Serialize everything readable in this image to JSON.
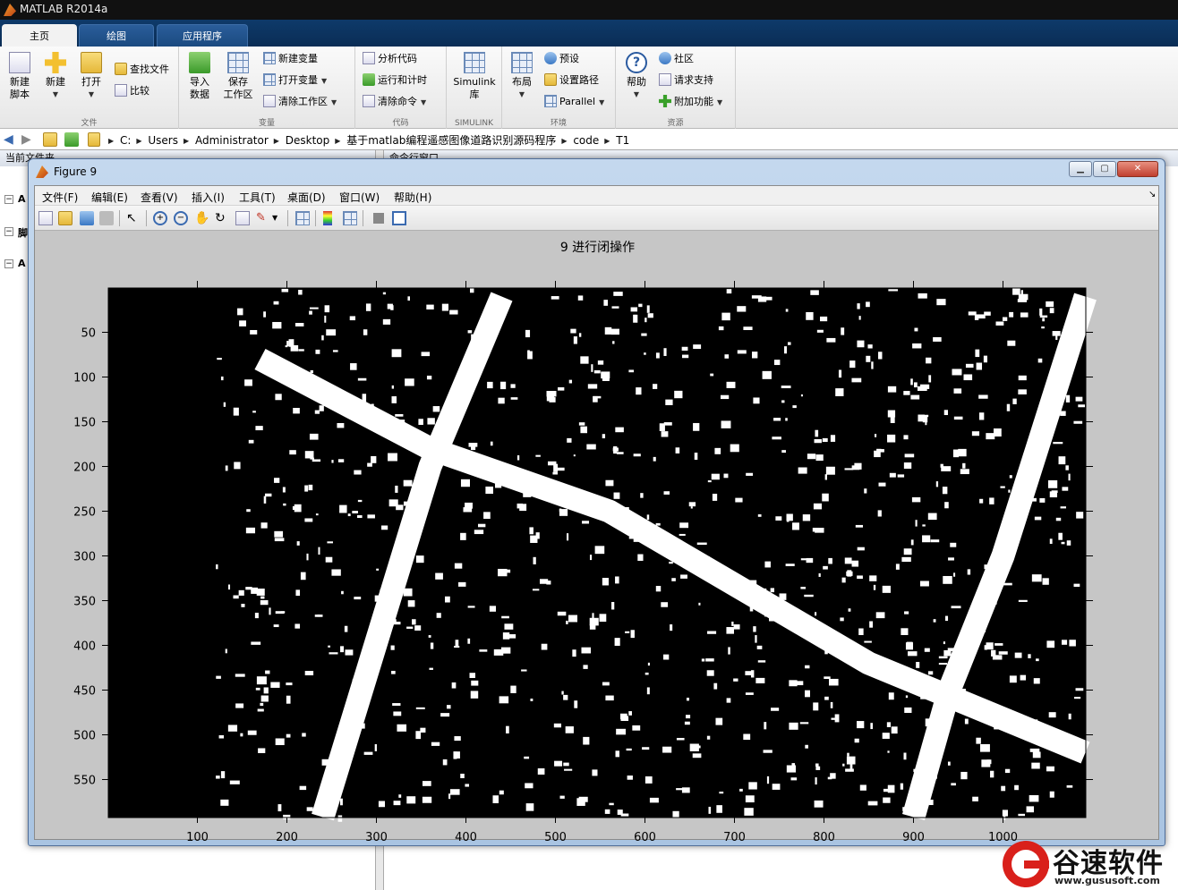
{
  "app": {
    "title": "MATLAB R2014a"
  },
  "ribbon_tabs": [
    "主页",
    "绘图",
    "应用程序"
  ],
  "ribbon": {
    "file": {
      "label": "文件",
      "new_script": "新建\n脚本",
      "new": "新建",
      "open": "打开",
      "find_files": "查找文件",
      "compare": "比较"
    },
    "variable": {
      "label": "变量",
      "import": "导入\n数据",
      "save_ws": "保存\n工作区",
      "new_var": "新建变量",
      "open_var": "打开变量",
      "clear_ws": "清除工作区"
    },
    "code": {
      "label": "代码",
      "analyze": "分析代码",
      "run_time": "运行和计时",
      "clear_cmd": "清除命令"
    },
    "simulink": {
      "label": "SIMULINK",
      "lib": "Simulink\n库"
    },
    "env": {
      "label": "环境",
      "layout": "布局",
      "prefs": "预设",
      "set_path": "设置路径",
      "parallel": "Parallel"
    },
    "resources": {
      "label": "资源",
      "help": "帮助",
      "community": "社区",
      "support": "请求支持",
      "addons": "附加功能"
    }
  },
  "breadcrumb": [
    "C:",
    "Users",
    "Administrator",
    "Desktop",
    "基于matlab编程遥感图像道路识别源码程序",
    "code",
    "T1"
  ],
  "panels": {
    "current_folder": "当前文件夹",
    "command_window": "命令行窗口",
    "tree_items": [
      "A",
      "脚",
      "A"
    ]
  },
  "figure": {
    "title": "Figure 9",
    "menus": [
      "文件(F)",
      "编辑(E)",
      "查看(V)",
      "插入(I)",
      "工具(T)",
      "桌面(D)",
      "窗口(W)",
      "帮助(H)"
    ],
    "plot_title": "9 进行闭操作"
  },
  "chart_data": {
    "type": "image",
    "title": "9 进行闭操作",
    "x_ticks": [
      100,
      200,
      300,
      400,
      500,
      600,
      700,
      800,
      900,
      1000
    ],
    "y_ticks": [
      50,
      100,
      150,
      200,
      250,
      300,
      350,
      400,
      450,
      500,
      550
    ],
    "xlim": [
      0.5,
      1092.5
    ],
    "ylim": [
      0.5,
      592.5
    ],
    "roads": [
      {
        "name": "diagonal-road-1",
        "points": [
          [
            440,
            10
          ],
          [
            360,
            200
          ],
          [
            240,
            592
          ]
        ]
      },
      {
        "name": "diagonal-road-2",
        "points": [
          [
            170,
            80
          ],
          [
            360,
            180
          ],
          [
            560,
            250
          ],
          [
            850,
            420
          ],
          [
            1092,
            520
          ]
        ]
      },
      {
        "name": "vertical-road-right",
        "points": [
          [
            1092,
            10
          ],
          [
            1000,
            300
          ],
          [
            940,
            450
          ],
          [
            900,
            592
          ]
        ]
      }
    ]
  },
  "watermark": {
    "name": "谷速软件",
    "url": "www.gususoft.com"
  }
}
